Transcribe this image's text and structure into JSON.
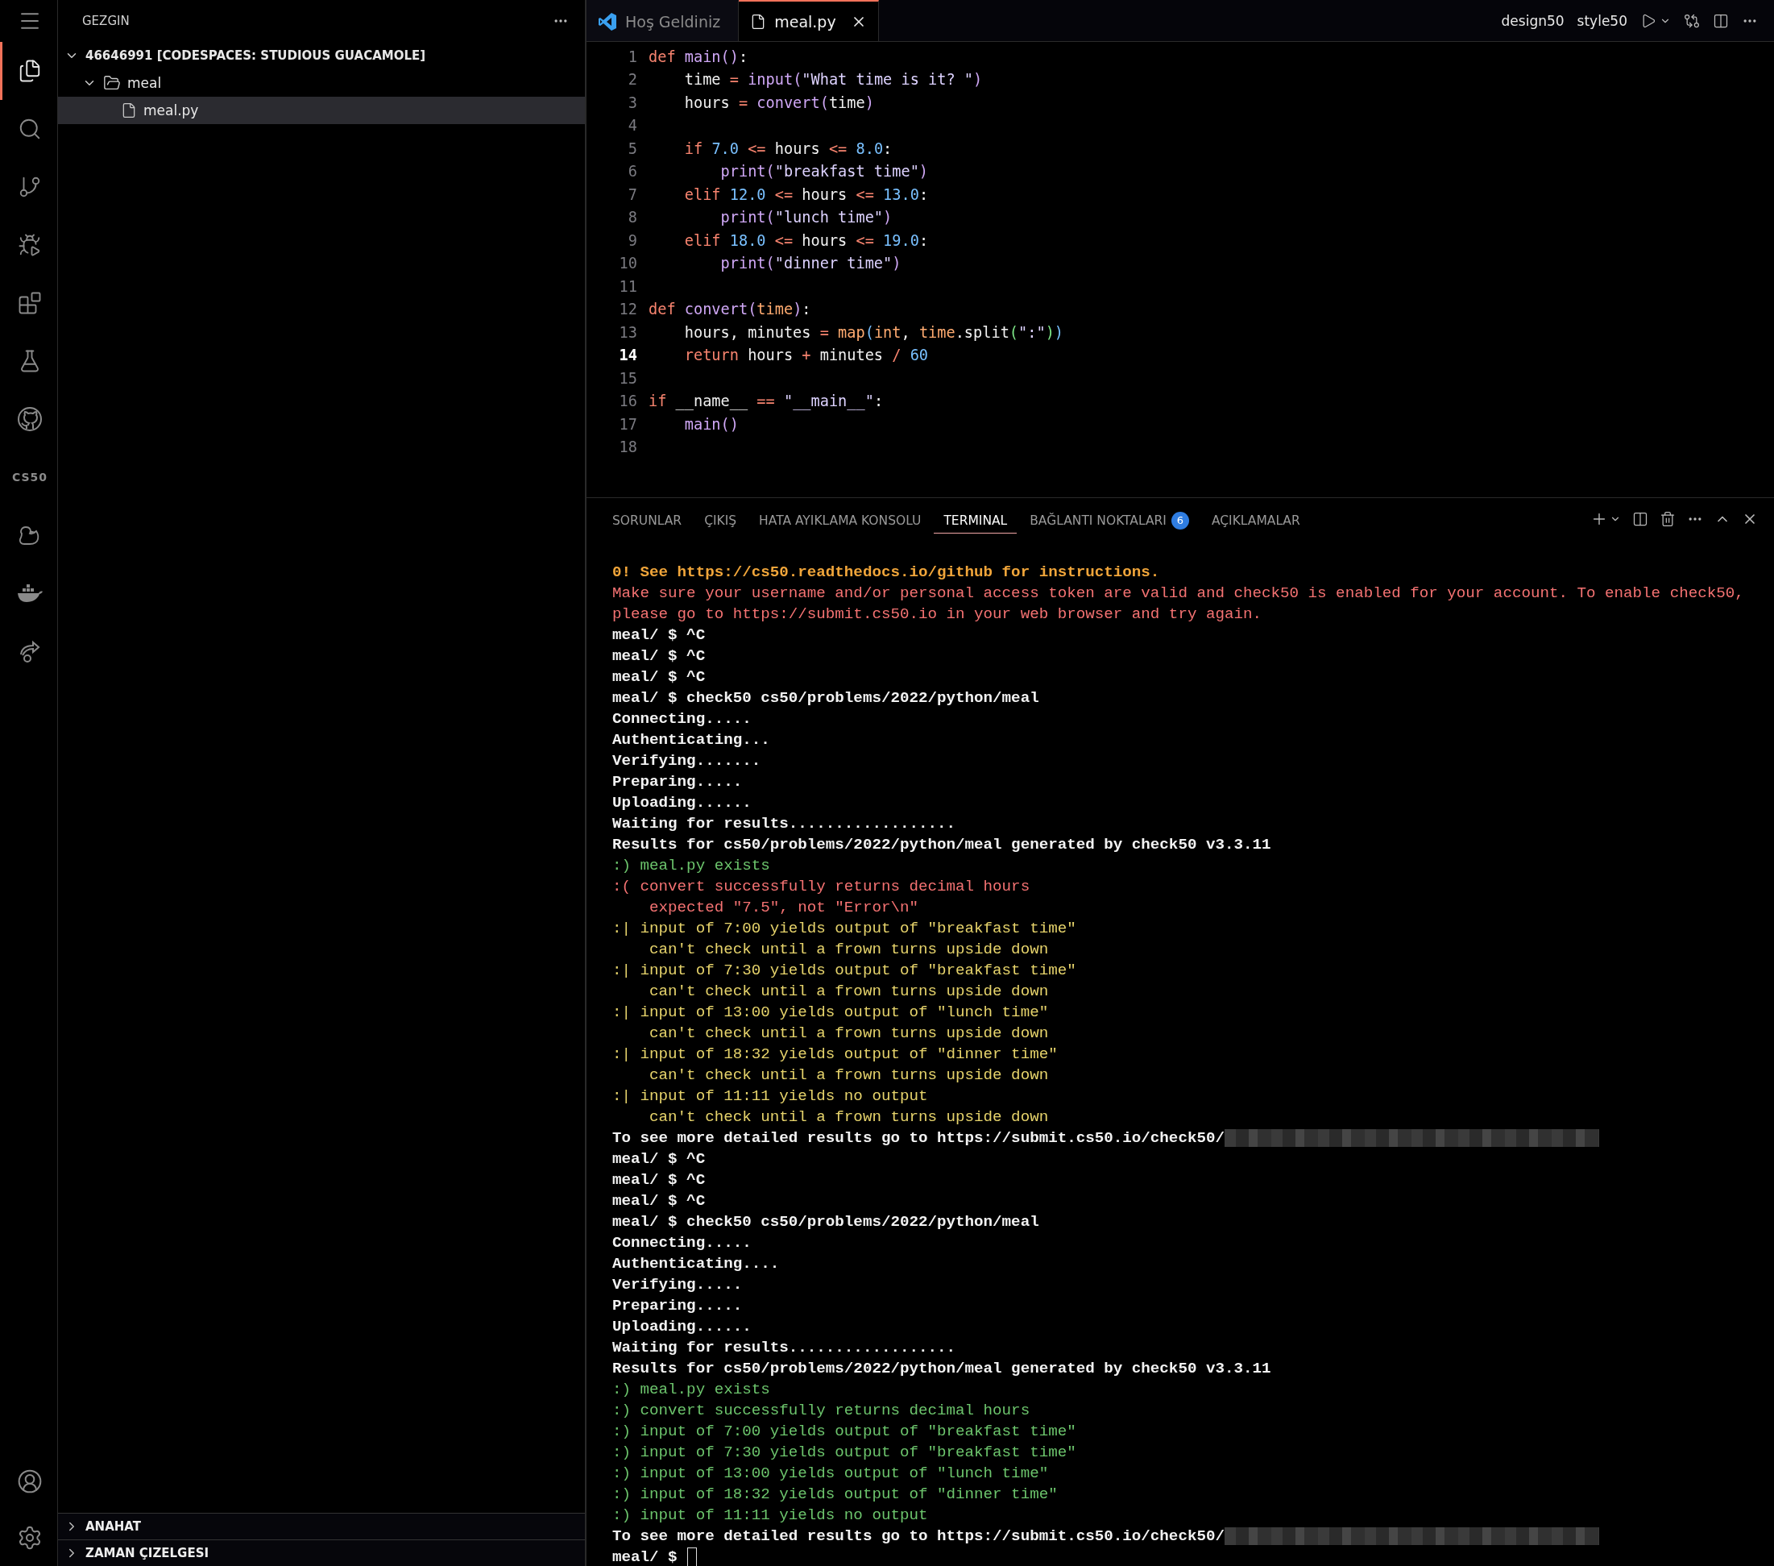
{
  "activity_bar": {
    "top_items": [
      {
        "selected": false
      },
      {
        "selected": true
      },
      {
        "selected": false
      },
      {
        "selected": false
      },
      {
        "selected": false
      },
      {
        "selected": false
      },
      {
        "selected": false
      },
      {
        "selected": false
      },
      {
        "label": "CS50",
        "selected": false
      },
      {
        "selected": false
      },
      {
        "selected": false
      },
      {
        "selected": false
      }
    ],
    "bottom_items": [
      {
        "selected": false
      },
      {
        "selected": false
      }
    ]
  },
  "sidebar": {
    "title": "GEZGIN",
    "tree": [
      {
        "label": "46646991 [CODESPACES: STUDIOUS GUACAMOLE]",
        "kind": "root",
        "expanded": true,
        "selected": false,
        "children": [
          {
            "label": "meal",
            "kind": "folder",
            "expanded": true,
            "selected": false,
            "children": [
              {
                "label": "meal.py",
                "kind": "file",
                "selected": true
              }
            ]
          }
        ]
      }
    ],
    "sections": [
      {
        "label": "ANAHAT",
        "expanded": false
      },
      {
        "label": "ZAMAN ÇIZELGESI",
        "expanded": false
      }
    ]
  },
  "editor": {
    "tabs": [
      {
        "label": "Hoş Geldiniz",
        "kind": "welcome",
        "selected": false
      },
      {
        "label": "meal.py",
        "kind": "file",
        "selected": true
      }
    ],
    "actions": [
      "design50",
      "style50"
    ],
    "lines": [
      {
        "number": "1",
        "current": false,
        "tokens": [
          {
            "text": "def ",
            "kind": "kw"
          },
          {
            "text": "main",
            "kind": "fn"
          },
          {
            "text": "()",
            "kind": "p1"
          },
          {
            "text": ":",
            "kind": "plain"
          }
        ]
      },
      {
        "number": "2",
        "current": false,
        "tokens": [
          {
            "text": "    time ",
            "kind": "var"
          },
          {
            "text": "= ",
            "kind": "op"
          },
          {
            "text": "input",
            "kind": "fn"
          },
          {
            "text": "(",
            "kind": "p1"
          },
          {
            "text": "\"What time is it? \"",
            "kind": "str"
          },
          {
            "text": ")",
            "kind": "p1"
          }
        ]
      },
      {
        "number": "3",
        "current": false,
        "tokens": [
          {
            "text": "    hours ",
            "kind": "var"
          },
          {
            "text": "= ",
            "kind": "op"
          },
          {
            "text": "convert",
            "kind": "fn"
          },
          {
            "text": "(",
            "kind": "p1"
          },
          {
            "text": "time",
            "kind": "var"
          },
          {
            "text": ")",
            "kind": "p1"
          }
        ]
      },
      {
        "number": "4",
        "current": false
      },
      {
        "number": "5",
        "current": false,
        "tokens": [
          {
            "text": "    if ",
            "kind": "kw"
          },
          {
            "text": "7.0 ",
            "kind": "num"
          },
          {
            "text": "<= ",
            "kind": "op"
          },
          {
            "text": "hours ",
            "kind": "var"
          },
          {
            "text": "<= ",
            "kind": "op"
          },
          {
            "text": "8.0",
            "kind": "num"
          },
          {
            "text": ":",
            "kind": "plain"
          }
        ]
      },
      {
        "number": "6",
        "current": false,
        "tokens": [
          {
            "text": "        print",
            "kind": "fn"
          },
          {
            "text": "(",
            "kind": "p1"
          },
          {
            "text": "\"breakfast time\"",
            "kind": "str"
          },
          {
            "text": ")",
            "kind": "p1"
          }
        ]
      },
      {
        "number": "7",
        "current": false,
        "tokens": [
          {
            "text": "    elif ",
            "kind": "kw"
          },
          {
            "text": "12.0 ",
            "kind": "num"
          },
          {
            "text": "<= ",
            "kind": "op"
          },
          {
            "text": "hours ",
            "kind": "var"
          },
          {
            "text": "<= ",
            "kind": "op"
          },
          {
            "text": "13.0",
            "kind": "num"
          },
          {
            "text": ":",
            "kind": "plain"
          }
        ]
      },
      {
        "number": "8",
        "current": false,
        "tokens": [
          {
            "text": "        print",
            "kind": "fn"
          },
          {
            "text": "(",
            "kind": "p1"
          },
          {
            "text": "\"lunch time\"",
            "kind": "str"
          },
          {
            "text": ")",
            "kind": "p1"
          }
        ]
      },
      {
        "number": "9",
        "current": false,
        "tokens": [
          {
            "text": "    elif ",
            "kind": "kw"
          },
          {
            "text": "18.0 ",
            "kind": "num"
          },
          {
            "text": "<= ",
            "kind": "op"
          },
          {
            "text": "hours ",
            "kind": "var"
          },
          {
            "text": "<= ",
            "kind": "op"
          },
          {
            "text": "19.0",
            "kind": "num"
          },
          {
            "text": ":",
            "kind": "plain"
          }
        ]
      },
      {
        "number": "10",
        "current": false,
        "tokens": [
          {
            "text": "        print",
            "kind": "fn"
          },
          {
            "text": "(",
            "kind": "p1"
          },
          {
            "text": "\"dinner time\"",
            "kind": "str"
          },
          {
            "text": ")",
            "kind": "p1"
          }
        ]
      },
      {
        "number": "11",
        "current": false
      },
      {
        "number": "12",
        "current": false,
        "tokens": [
          {
            "text": "def ",
            "kind": "kw"
          },
          {
            "text": "convert",
            "kind": "fn"
          },
          {
            "text": "(",
            "kind": "p1"
          },
          {
            "text": "time",
            "kind": "param"
          },
          {
            "text": ")",
            "kind": "p1"
          },
          {
            "text": ":",
            "kind": "plain"
          }
        ]
      },
      {
        "number": "13",
        "current": false,
        "tokens": [
          {
            "text": "    hours, minutes ",
            "kind": "var"
          },
          {
            "text": "= ",
            "kind": "op"
          },
          {
            "text": "map",
            "kind": "param"
          },
          {
            "text": "(",
            "kind": "p3"
          },
          {
            "text": "int",
            "kind": "param"
          },
          {
            "text": ", ",
            "kind": "plain"
          },
          {
            "text": "time",
            "kind": "param"
          },
          {
            "text": ".split",
            "kind": "var"
          },
          {
            "text": "(",
            "kind": "p2"
          },
          {
            "text": "\":\"",
            "kind": "str"
          },
          {
            "text": ")",
            "kind": "p2"
          },
          {
            "text": ")",
            "kind": "p3"
          }
        ]
      },
      {
        "number": "14",
        "current": true,
        "tokens": [
          {
            "text": "    return ",
            "kind": "kw"
          },
          {
            "text": "hours ",
            "kind": "var"
          },
          {
            "text": "+ ",
            "kind": "op"
          },
          {
            "text": "minutes ",
            "kind": "var"
          },
          {
            "text": "/ ",
            "kind": "op"
          },
          {
            "text": "60",
            "kind": "num"
          }
        ]
      },
      {
        "number": "15",
        "current": false
      },
      {
        "number": "16",
        "current": false,
        "tokens": [
          {
            "text": "if ",
            "kind": "kw"
          },
          {
            "text": "__name__ ",
            "kind": "var"
          },
          {
            "text": "== ",
            "kind": "op"
          },
          {
            "text": "\"__main__\"",
            "kind": "str"
          },
          {
            "text": ":",
            "kind": "plain"
          }
        ]
      },
      {
        "number": "17",
        "current": false,
        "tokens": [
          {
            "text": "    main",
            "kind": "fn"
          },
          {
            "text": "()",
            "kind": "p1"
          }
        ]
      },
      {
        "number": "18",
        "current": false
      }
    ]
  },
  "panel": {
    "tabs": [
      {
        "label": "SORUNLAR",
        "selected": false
      },
      {
        "label": "ÇIKIŞ",
        "selected": false
      },
      {
        "label": "HATA AYIKLAMA KONSOLU",
        "selected": false
      },
      {
        "label": "TERMINAL",
        "selected": true
      },
      {
        "label": "BAĞLANTI NOKTALARI",
        "badge": "6",
        "selected": false
      },
      {
        "label": "AÇIKLAMALAR",
        "selected": false
      }
    ],
    "terminal": {
      "lines": [
        {
          "kind": "warning",
          "text": "0! See https://cs50.readthedocs.io/github for instructions."
        },
        {
          "kind": "error",
          "text": "Make sure your username and/or personal access token are valid and check50 is enabled for your account. To enable check50,"
        },
        {
          "kind": "error",
          "text": "please go to https://submit.cs50.io in your web browser and try again."
        },
        {
          "kind": "command",
          "text": "meal/ $ ^C"
        },
        {
          "kind": "command",
          "text": "meal/ $ ^C"
        },
        {
          "kind": "command",
          "text": "meal/ $ ^C"
        },
        {
          "kind": "command",
          "text": "meal/ $ check50 cs50/problems/2022/python/meal"
        },
        {
          "kind": "command",
          "text": "Connecting....."
        },
        {
          "kind": "command",
          "text": "Authenticating..."
        },
        {
          "kind": "command",
          "text": "Verifying......."
        },
        {
          "kind": "command",
          "text": "Preparing....."
        },
        {
          "kind": "command",
          "text": "Uploading......"
        },
        {
          "kind": "command",
          "text": "Waiting for results.................."
        },
        {
          "kind": "command",
          "text": "Results for cs50/problems/2022/python/meal generated by check50 v3.3.11"
        },
        {
          "kind": "pass",
          "text": ":) meal.py exists"
        },
        {
          "kind": "fail",
          "text": ":( convert successfully returns decimal hours"
        },
        {
          "kind": "fail",
          "text": "    expected \"7.5\", not \"Error\\n\""
        },
        {
          "kind": "skip",
          "text": ":| input of 7:00 yields output of \"breakfast time\""
        },
        {
          "kind": "skip",
          "text": "    can't check until a frown turns upside down"
        },
        {
          "kind": "skip",
          "text": ":| input of 7:30 yields output of \"breakfast time\""
        },
        {
          "kind": "skip",
          "text": "    can't check until a frown turns upside down"
        },
        {
          "kind": "skip",
          "text": ":| input of 13:00 yields output of \"lunch time\""
        },
        {
          "kind": "skip",
          "text": "    can't check until a frown turns upside down"
        },
        {
          "kind": "skip",
          "text": ":| input of 18:32 yields output of \"dinner time\""
        },
        {
          "kind": "skip",
          "text": "    can't check until a frown turns upside down"
        },
        {
          "kind": "skip",
          "text": ":| input of 11:11 yields no output"
        },
        {
          "kind": "skip",
          "text": "    can't check until a frown turns upside down"
        },
        {
          "kind": "link",
          "text": "To see more detailed results go to https://submit.cs50.io/check50/"
        },
        {
          "kind": "command",
          "text": "meal/ $ ^C"
        },
        {
          "kind": "command",
          "text": "meal/ $ ^C"
        },
        {
          "kind": "command",
          "text": "meal/ $ ^C"
        },
        {
          "kind": "command",
          "text": "meal/ $ check50 cs50/problems/2022/python/meal"
        },
        {
          "kind": "command",
          "text": "Connecting....."
        },
        {
          "kind": "command",
          "text": "Authenticating...."
        },
        {
          "kind": "command",
          "text": "Verifying....."
        },
        {
          "kind": "command",
          "text": "Preparing....."
        },
        {
          "kind": "command",
          "text": "Uploading......"
        },
        {
          "kind": "command",
          "text": "Waiting for results.................."
        },
        {
          "kind": "command",
          "text": "Results for cs50/problems/2022/python/meal generated by check50 v3.3.11"
        },
        {
          "kind": "pass",
          "text": ":) meal.py exists"
        },
        {
          "kind": "pass",
          "text": ":) convert successfully returns decimal hours"
        },
        {
          "kind": "pass",
          "text": ":) input of 7:00 yields output of \"breakfast time\""
        },
        {
          "kind": "pass",
          "text": ":) input of 7:30 yields output of \"breakfast time\""
        },
        {
          "kind": "pass",
          "text": ":) input of 13:00 yields output of \"lunch time\""
        },
        {
          "kind": "pass",
          "text": ":) input of 18:32 yields output of \"dinner time\""
        },
        {
          "kind": "pass",
          "text": ":) input of 11:11 yields no output"
        },
        {
          "kind": "link",
          "text": "To see more detailed results go to https://submit.cs50.io/check50/"
        },
        {
          "kind": "prompt",
          "text": "meal/ $"
        }
      ]
    }
  }
}
